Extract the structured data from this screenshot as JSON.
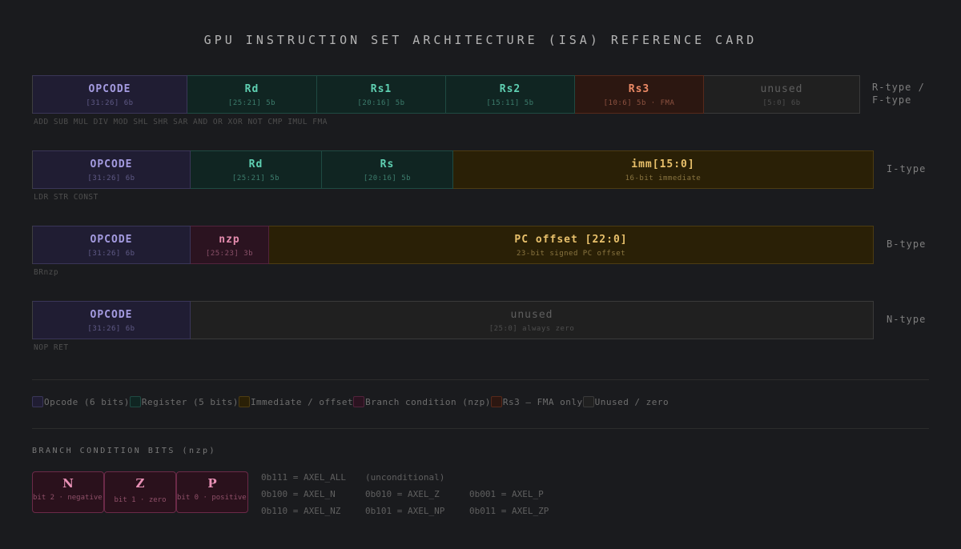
{
  "title": "GPU INSTRUCTION SET ARCHITECTURE (ISA) REFERENCE CARD",
  "formats": {
    "r": {
      "label_line1": "R-type /",
      "label_line2": "F-type",
      "fields": [
        {
          "name": "OPCODE",
          "sub": "[31:26] 6b"
        },
        {
          "name": "Rd",
          "sub": "[25:21] 5b"
        },
        {
          "name": "Rs1",
          "sub": "[20:16] 5b"
        },
        {
          "name": "Rs2",
          "sub": "[15:11] 5b"
        },
        {
          "name": "Rs3",
          "sub": "[10:6] 5b · FMA"
        },
        {
          "name": "unused",
          "sub": "[5:0] 6b"
        }
      ],
      "ops": "ADD SUB MUL DIV MOD SHL SHR SAR AND OR XOR NOT CMP IMUL FMA"
    },
    "i": {
      "label": "I-type",
      "fields": [
        {
          "name": "OPCODE",
          "sub": "[31:26] 6b"
        },
        {
          "name": "Rd",
          "sub": "[25:21] 5b"
        },
        {
          "name": "Rs",
          "sub": "[20:16] 5b"
        },
        {
          "name": "imm[15:0]",
          "sub": "16-bit immediate"
        }
      ],
      "ops": "LDR STR CONST"
    },
    "b": {
      "label": "B-type",
      "fields": [
        {
          "name": "OPCODE",
          "sub": "[31:26] 6b"
        },
        {
          "name": "nzp",
          "sub": "[25:23] 3b"
        },
        {
          "name": "PC offset [22:0]",
          "sub": "23-bit signed PC offset"
        }
      ],
      "ops": "BRnzp"
    },
    "n": {
      "label": "N-type",
      "fields": [
        {
          "name": "OPCODE",
          "sub": "[31:26] 6b"
        },
        {
          "name": "unused",
          "sub": "[25:0] always zero"
        }
      ],
      "ops": "NOP RET"
    }
  },
  "legend": [
    {
      "label": "Opcode (6 bits)",
      "color": "#201d33",
      "border": "#3a3658"
    },
    {
      "label": "Register (5 bits)",
      "color": "#102522",
      "border": "#1f4a42"
    },
    {
      "label": "Immediate / offset",
      "color": "#2a2006",
      "border": "#4d3c12"
    },
    {
      "label": "Branch condition (nzp)",
      "color": "#2b1320",
      "border": "#52233c"
    },
    {
      "label": "Rs3 — FMA only",
      "color": "#2c1711",
      "border": "#57291b"
    },
    {
      "label": "Unused / zero",
      "color": "#202020",
      "border": "#3a3a3a"
    }
  ],
  "branch": {
    "section_title": "BRANCH CONDITION BITS (nzp)",
    "bits": [
      {
        "letter": "N",
        "desc": "bit 2 · negative"
      },
      {
        "letter": "Z",
        "desc": "bit 1 · zero"
      },
      {
        "letter": "P",
        "desc": "bit 0 · positive"
      }
    ],
    "codes": [
      [
        "0b111 = AXEL_ALL",
        "(unconditional)",
        ""
      ],
      [
        "0b100 = AXEL_N",
        "0b010 = AXEL_Z",
        "0b001 = AXEL_P"
      ],
      [
        "0b110 = AXEL_NZ",
        "0b101 = AXEL_NP",
        "0b011 = AXEL_ZP"
      ]
    ]
  },
  "colors": {
    "background": "#1a1b1e",
    "opcode": "#a49be0",
    "register": "#5fd0b2",
    "rs3": "#ec8a66",
    "immediate": "#e8c06b",
    "branch": "#e58cae"
  }
}
